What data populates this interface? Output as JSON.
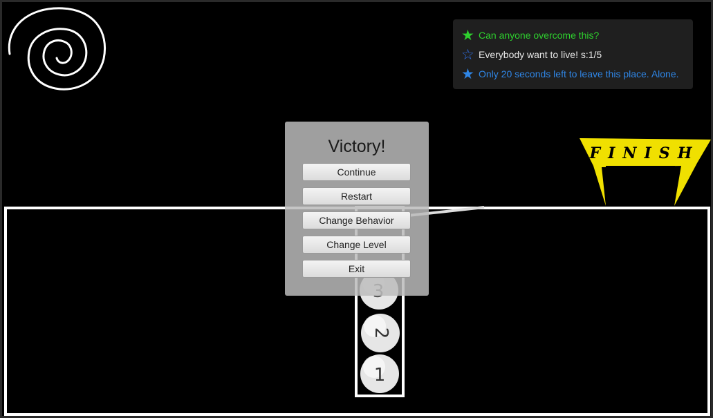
{
  "objectives": [
    {
      "star": "★",
      "text": "Can anyone overcome this?",
      "color": "#2ed02e"
    },
    {
      "star": "☆",
      "text": "Everybody want to live! s:1/5",
      "color": "#e8e8e8",
      "star_color": "#2f6fe6"
    },
    {
      "star": "★",
      "text": "Only 20 seconds left to leave this place. Alone.",
      "color": "#2f86e6"
    }
  ],
  "victory": {
    "title": "Victory!",
    "buttons": {
      "continue": "Continue",
      "restart": "Restart",
      "change_behavior": "Change Behavior",
      "change_level": "Change Level",
      "exit": "Exit"
    }
  },
  "finish_flag": {
    "text": "FINISH",
    "color": "#f0e000"
  },
  "balls": [
    "1",
    "2",
    "3"
  ],
  "icons": {
    "portal": "spiral-icon"
  }
}
